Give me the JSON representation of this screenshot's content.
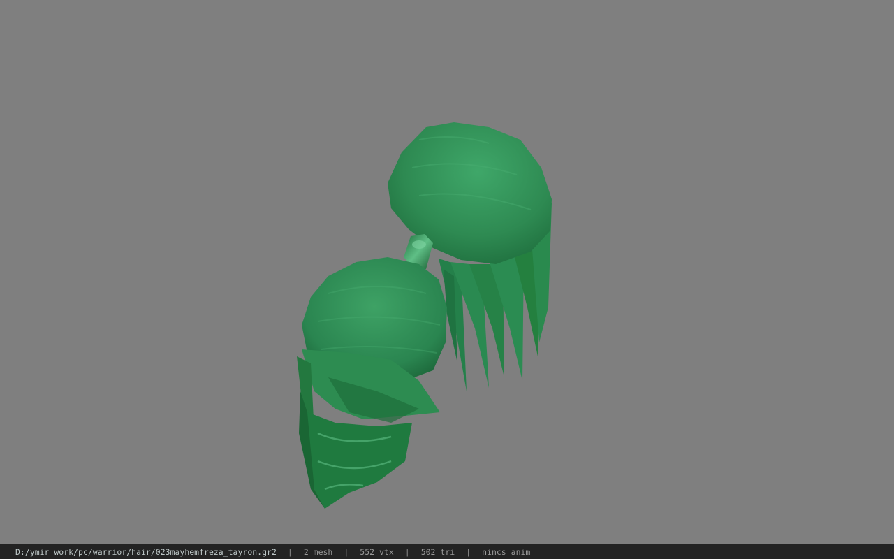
{
  "viewer": {
    "background_color": "#7f7f7f",
    "model_color": "#2e8b4f",
    "model_shape": "green-ponytail-hair-mesh"
  },
  "status_bar": {
    "file_path": "D:/ymir work/pc/warrior/hair/023mayhemfreza_tayron.gr2",
    "separator": "|",
    "mesh_count": "2 mesh",
    "vertex_count": "552 vtx",
    "triangle_count": "502 tri",
    "anim_status": "nincs anim"
  }
}
